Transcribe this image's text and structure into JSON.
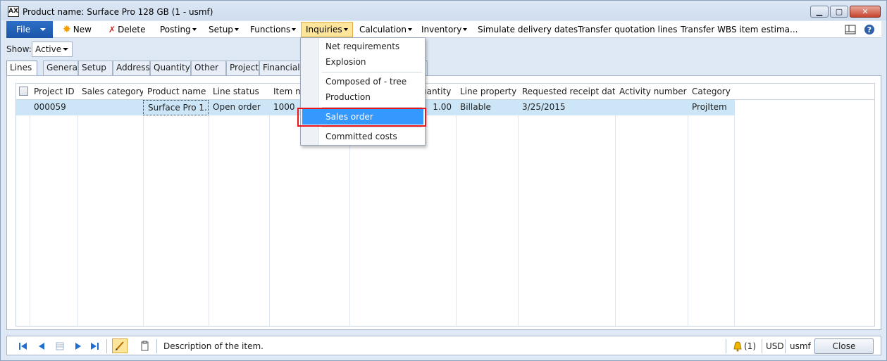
{
  "window": {
    "title": "Product name: Surface Pro 128 GB (1 - usmf)",
    "app_icon_text": "AX"
  },
  "menubar": {
    "file": "File",
    "new": "New",
    "delete": "Delete",
    "posting": "Posting",
    "setup": "Setup",
    "functions": "Functions",
    "inquiries": "Inquiries",
    "calculation": "Calculation",
    "inventory": "Inventory",
    "simulate": "Simulate delivery dates",
    "transfer_quotation": "Transfer quotation lines",
    "transfer_wbs": "Transfer WBS item estima..."
  },
  "show": {
    "label": "Show:",
    "value": "Active"
  },
  "tabs": [
    "Lines",
    "General",
    "Setup",
    "Address",
    "Quantity",
    "Other",
    "Project",
    "Financial"
  ],
  "grid": {
    "columns": [
      "Project ID",
      "Sales category",
      "Product name",
      "Line status",
      "Item nu",
      "uantity",
      "Line property",
      "Requested receipt date",
      "Activity number",
      "Category"
    ],
    "row": {
      "project_id": "000059",
      "sales_category": "",
      "product_name": "Surface Pro 1...",
      "line_status": "Open order",
      "item_number": "1000",
      "quantity": "1.00",
      "line_property": "Billable",
      "requested_receipt_date": "3/25/2015",
      "activity_number": "",
      "category": "ProjItem"
    }
  },
  "dropdown": {
    "items": [
      "Net requirements",
      "Explosion",
      "Composed of - tree",
      "Production",
      "Sales order",
      "Committed costs"
    ],
    "highlighted": "Sales order"
  },
  "statusbar": {
    "description": "Description of the item.",
    "notifications": "(1)",
    "currency": "USD",
    "company": "usmf",
    "close": "Close"
  },
  "colors": {
    "accent": "#1b56a8",
    "highlight": "#3399ff",
    "selected_row": "#cde6f7",
    "annotation_box": "#e8151a",
    "active_menu": "#fde59b"
  }
}
